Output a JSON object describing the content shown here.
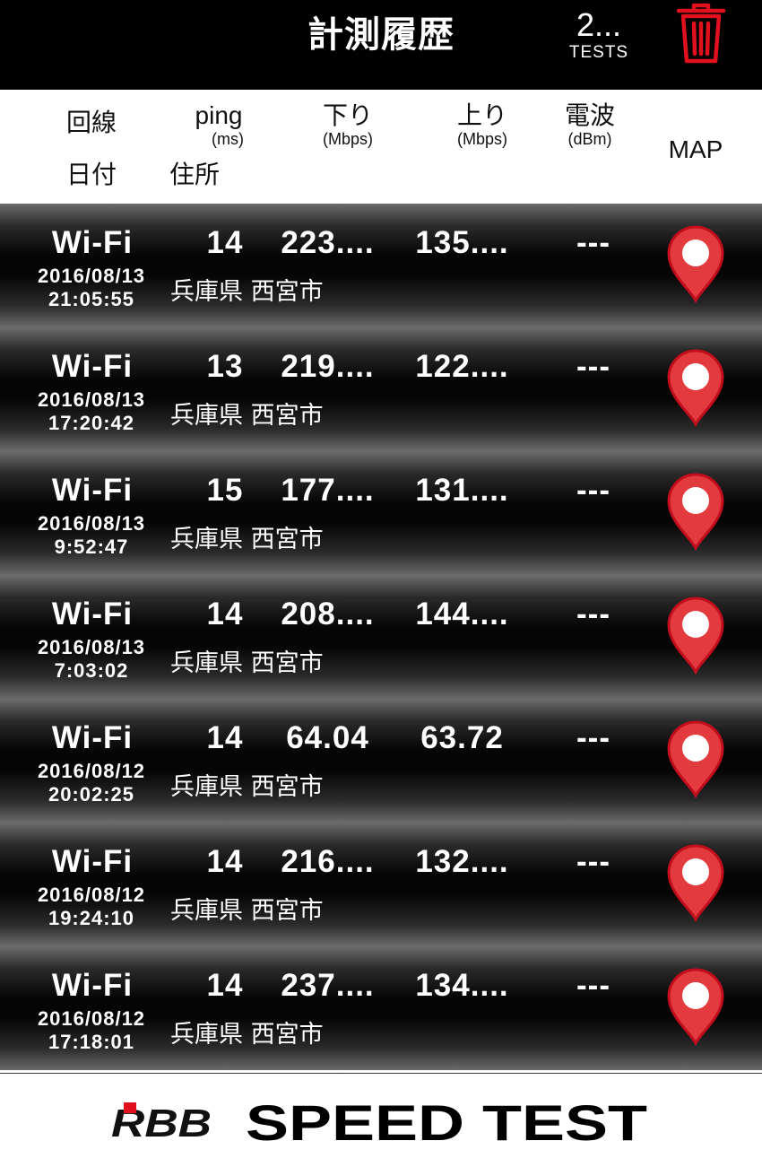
{
  "header": {
    "title": "計測履歴",
    "test_count": "2...",
    "test_count_label": "TESTS",
    "trash_icon": "trash-icon"
  },
  "columns": {
    "line": "回線",
    "ping": "ping",
    "ping_unit": "(ms)",
    "download": "下り",
    "download_unit": "(Mbps)",
    "upload": "上り",
    "upload_unit": "(Mbps)",
    "signal": "電波",
    "signal_unit": "(dBm)",
    "map": "MAP",
    "date": "日付",
    "address": "住所"
  },
  "rows": [
    {
      "line": "Wi-Fi",
      "ping": "14",
      "download": "223....",
      "upload": "135....",
      "signal": "---",
      "date": "2016/08/13",
      "time": "21:05:55",
      "address": "兵庫県 西宮市"
    },
    {
      "line": "Wi-Fi",
      "ping": "13",
      "download": "219....",
      "upload": "122....",
      "signal": "---",
      "date": "2016/08/13",
      "time": "17:20:42",
      "address": "兵庫県 西宮市"
    },
    {
      "line": "Wi-Fi",
      "ping": "15",
      "download": "177....",
      "upload": "131....",
      "signal": "---",
      "date": "2016/08/13",
      "time": "9:52:47",
      "address": "兵庫県 西宮市"
    },
    {
      "line": "Wi-Fi",
      "ping": "14",
      "download": "208....",
      "upload": "144....",
      "signal": "---",
      "date": "2016/08/13",
      "time": "7:03:02",
      "address": "兵庫県 西宮市"
    },
    {
      "line": "Wi-Fi",
      "ping": "14",
      "download": "64.04",
      "upload": "63.72",
      "signal": "---",
      "date": "2016/08/12",
      "time": "20:02:25",
      "address": "兵庫県 西宮市"
    },
    {
      "line": "Wi-Fi",
      "ping": "14",
      "download": "216....",
      "upload": "132....",
      "signal": "---",
      "date": "2016/08/12",
      "time": "19:24:10",
      "address": "兵庫県 西宮市"
    },
    {
      "line": "Wi-Fi",
      "ping": "14",
      "download": "237....",
      "upload": "134....",
      "signal": "---",
      "date": "2016/08/12",
      "time": "17:18:01",
      "address": "兵庫県 西宮市"
    }
  ],
  "footer": {
    "logo_brand": "RBB",
    "logo_product": "SPEED TEST"
  },
  "colors": {
    "accent_red": "#e0101e",
    "pin_red": "#e23a3f",
    "header_bg": "#000000"
  }
}
